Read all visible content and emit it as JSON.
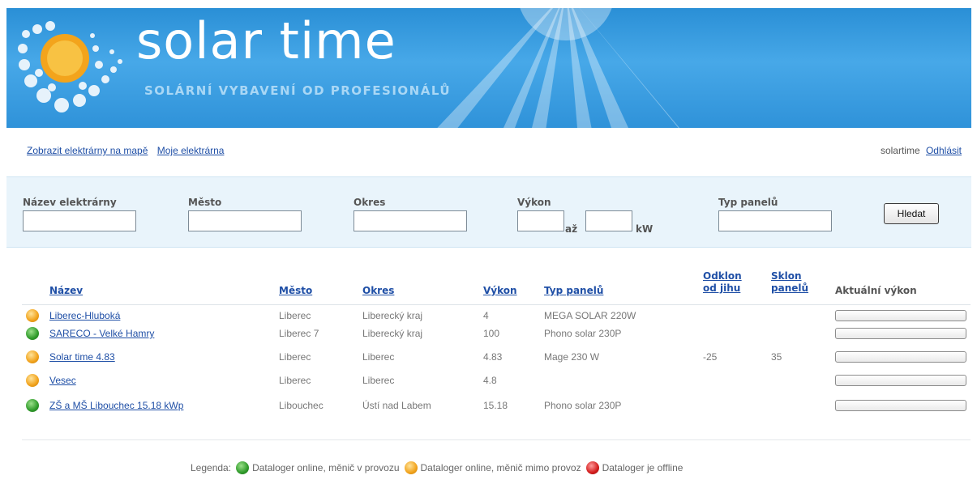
{
  "header": {
    "brand": "solar time",
    "tagline": "SOLÁRNÍ VYBAVENÍ OD PROFESIONÁLŮ",
    "colors": {
      "banner": "#2a8fd6",
      "tagline": "#a9d7f5"
    }
  },
  "nav": {
    "links": [
      "Zobrazit elektrárny na mapě",
      "Moje elektrárna"
    ],
    "user": "solartime",
    "logout": "Odhlásit"
  },
  "search": {
    "name_label": "Název elektrárny",
    "city_label": "Město",
    "district_label": "Okres",
    "power_label": "Výkon",
    "to_label": "až",
    "unit_label": "kW",
    "panel_label": "Typ panelů",
    "button": "Hledat"
  },
  "table": {
    "headers": {
      "name": "Název",
      "city": "Město",
      "district": "Okres",
      "power": "Výkon",
      "panel": "Typ panelů",
      "deviation": "Odklon od jihu",
      "tilt": "Sklon panelů",
      "current": "Aktuální výkon"
    },
    "rows": [
      {
        "status": "orange",
        "name": "Liberec-Hluboká",
        "city": "Liberec",
        "district": "Liberecký kraj",
        "power": "4",
        "panel": "MEGA SOLAR 220W",
        "deviation": "",
        "tilt": ""
      },
      {
        "status": "green",
        "name": "SARECO - Velké Hamry",
        "city": "Liberec 7",
        "district": "Liberecký kraj",
        "power": "100",
        "panel": "Phono solar 230P",
        "deviation": "",
        "tilt": ""
      },
      {
        "status": "orange",
        "name": "Solar time 4.83",
        "city": "Liberec",
        "district": "Liberec",
        "power": "4.83",
        "panel": "Mage 230 W",
        "deviation": "-25",
        "tilt": "35"
      },
      {
        "status": "orange",
        "name": "Vesec",
        "city": "Liberec",
        "district": "Liberec",
        "power": "4.8",
        "panel": "",
        "deviation": "",
        "tilt": ""
      },
      {
        "status": "green",
        "name": "ZŠ a MŠ Libouchec 15.18 kWp",
        "city": "Libouchec",
        "district": "Ústí nad Labem",
        "power": "15.18",
        "panel": "Phono solar 230P",
        "deviation": "",
        "tilt": ""
      }
    ]
  },
  "legend": {
    "title": "Legenda:",
    "items": [
      {
        "status": "green",
        "text": "Dataloger online, měnič v provozu"
      },
      {
        "status": "orange",
        "text": "Dataloger online, měnič mimo provoz"
      },
      {
        "status": "red",
        "text": "Dataloger je offline"
      }
    ]
  },
  "status_colors": {
    "green": "#2f9a2a",
    "orange": "#f1a21b",
    "red": "#d21c1c"
  }
}
